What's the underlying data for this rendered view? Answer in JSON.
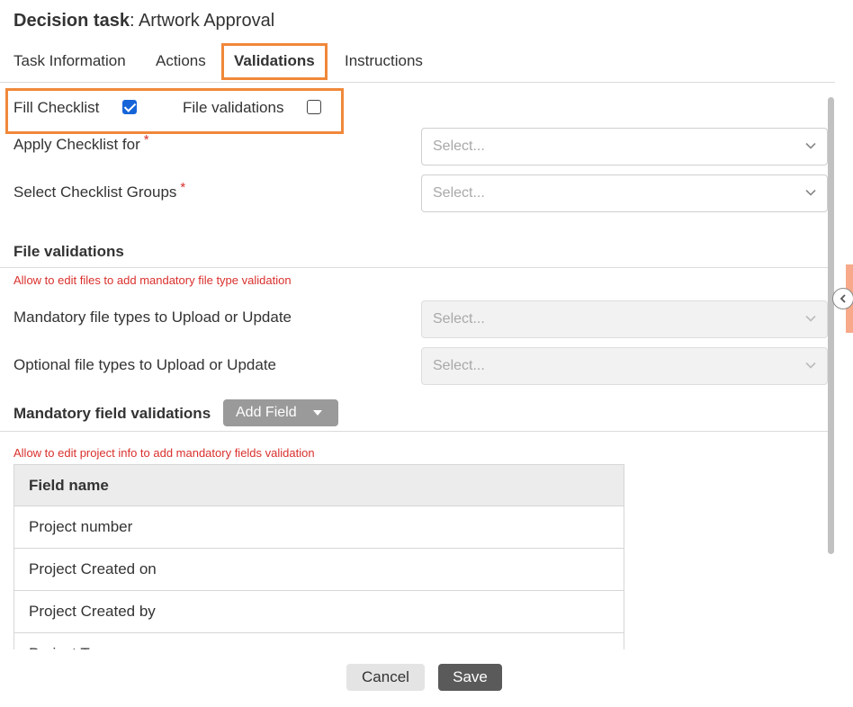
{
  "dialog": {
    "title_bold": "Decision task",
    "title_rest": ": Artwork Approval"
  },
  "tabs": [
    {
      "label": "Task Information",
      "active": false
    },
    {
      "label": "Actions",
      "active": false
    },
    {
      "label": "Validations",
      "active": true
    },
    {
      "label": "Instructions",
      "active": false
    }
  ],
  "checks": {
    "fill_checklist": {
      "label": "Fill Checklist",
      "checked": true
    },
    "file_validations": {
      "label": "File validations",
      "checked": false
    }
  },
  "fields": {
    "apply_checklist": {
      "label": "Apply Checklist for",
      "required_mark": "*",
      "placeholder": "Select..."
    },
    "checklist_groups": {
      "label": "Select Checklist Groups",
      "required_mark": "*",
      "placeholder": "Select..."
    }
  },
  "file_validations": {
    "title": "File validations",
    "note": "Allow to edit files to add mandatory file type validation",
    "mandatory": {
      "label": "Mandatory file types to Upload or Update",
      "placeholder": "Select..."
    },
    "optional": {
      "label": "Optional file types to Upload or Update",
      "placeholder": "Select..."
    }
  },
  "mandatory_fields": {
    "title": "Mandatory field validations",
    "add_button": "Add Field",
    "note": "Allow to edit project info to add mandatory fields validation",
    "table": {
      "header": "Field name",
      "rows": [
        "Project number",
        "Project Created on",
        "Project Created by",
        "Project Type"
      ]
    }
  },
  "footer": {
    "cancel": "Cancel",
    "save": "Save"
  },
  "colors": {
    "highlight": "#f0883a",
    "checkbox_checked": "#1565d8",
    "required": "#d9302c",
    "save_button": "#5a5a5a"
  }
}
